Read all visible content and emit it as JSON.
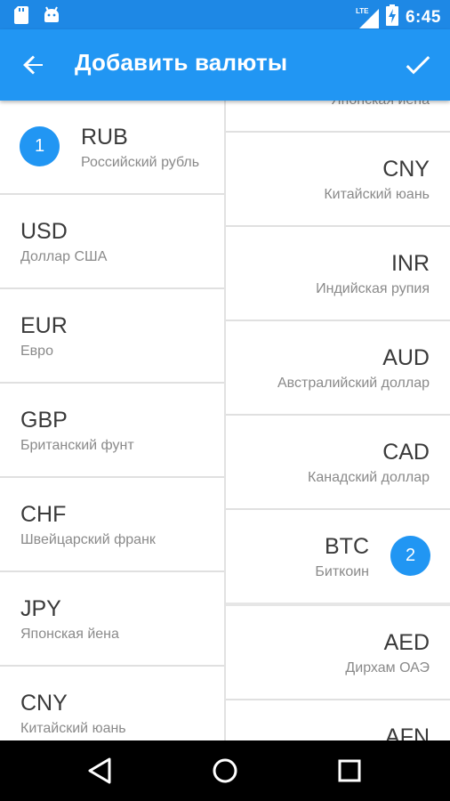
{
  "status_bar": {
    "time": "6:45",
    "network": "LTE",
    "icons": [
      "sd-card-icon",
      "android-icon",
      "signal-icon",
      "battery-charging-icon"
    ]
  },
  "app_bar": {
    "title": "Добавить валюты",
    "back_icon": "arrow-back-icon",
    "confirm_icon": "check-icon"
  },
  "left_list": [
    {
      "badge": "1",
      "code": "RUB",
      "name": "Российский рубль"
    },
    {
      "code": "USD",
      "name": "Доллар США"
    },
    {
      "code": "EUR",
      "name": "Евро"
    },
    {
      "code": "GBP",
      "name": "Британский фунт"
    },
    {
      "code": "CHF",
      "name": "Швейцарский франк"
    },
    {
      "code": "JPY",
      "name": "Японская йена"
    },
    {
      "code": "CNY",
      "name": "Китайский юань"
    }
  ],
  "right_list": {
    "partial_top_name": "Японская йена",
    "items": [
      {
        "code": "CNY",
        "name": "Китайский юань"
      },
      {
        "code": "INR",
        "name": "Индийская рупия"
      },
      {
        "code": "AUD",
        "name": "Австралийский доллар"
      },
      {
        "code": "CAD",
        "name": "Канадский доллар"
      },
      {
        "code": "BTC",
        "name": "Биткоин",
        "badge": "2"
      },
      {
        "code": "AED",
        "name": "Дирхам ОАЭ"
      },
      {
        "code": "AFN",
        "name": ""
      }
    ]
  },
  "nav_bar": {
    "icons": [
      "back-triangle-icon",
      "home-circle-icon",
      "recents-square-icon"
    ]
  },
  "colors": {
    "status_bar": "#1E88E5",
    "app_bar": "#2196F3",
    "badge": "#2196F3"
  }
}
